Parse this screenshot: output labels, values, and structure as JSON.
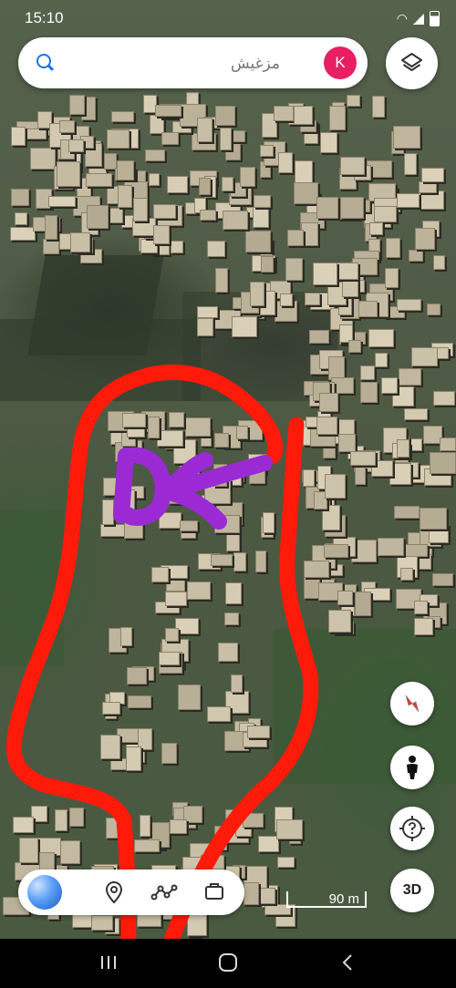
{
  "status_bar": {
    "time": "15:10"
  },
  "search": {
    "placeholder": "مزغيش",
    "avatar_letter": "K"
  },
  "buttons": {
    "three_d_label": "3D"
  },
  "scale": {
    "label": "90 m"
  },
  "icons": {
    "search": "search-icon",
    "layers": "layers-icon",
    "compass": "compass-icon",
    "street_view": "pegman-icon",
    "help": "help-icon",
    "earth": "earth-icon",
    "pin": "pin-icon",
    "measure": "measure-icon",
    "projects": "projects-icon",
    "nav_recents": "recents-icon",
    "nav_home": "home-icon",
    "nav_back": "back-icon"
  },
  "colors": {
    "avatar": "#e91e63",
    "search_accent": "#1a73e8",
    "annotation_red": "#ff1a0a",
    "annotation_purple": "#9b2ad4"
  }
}
